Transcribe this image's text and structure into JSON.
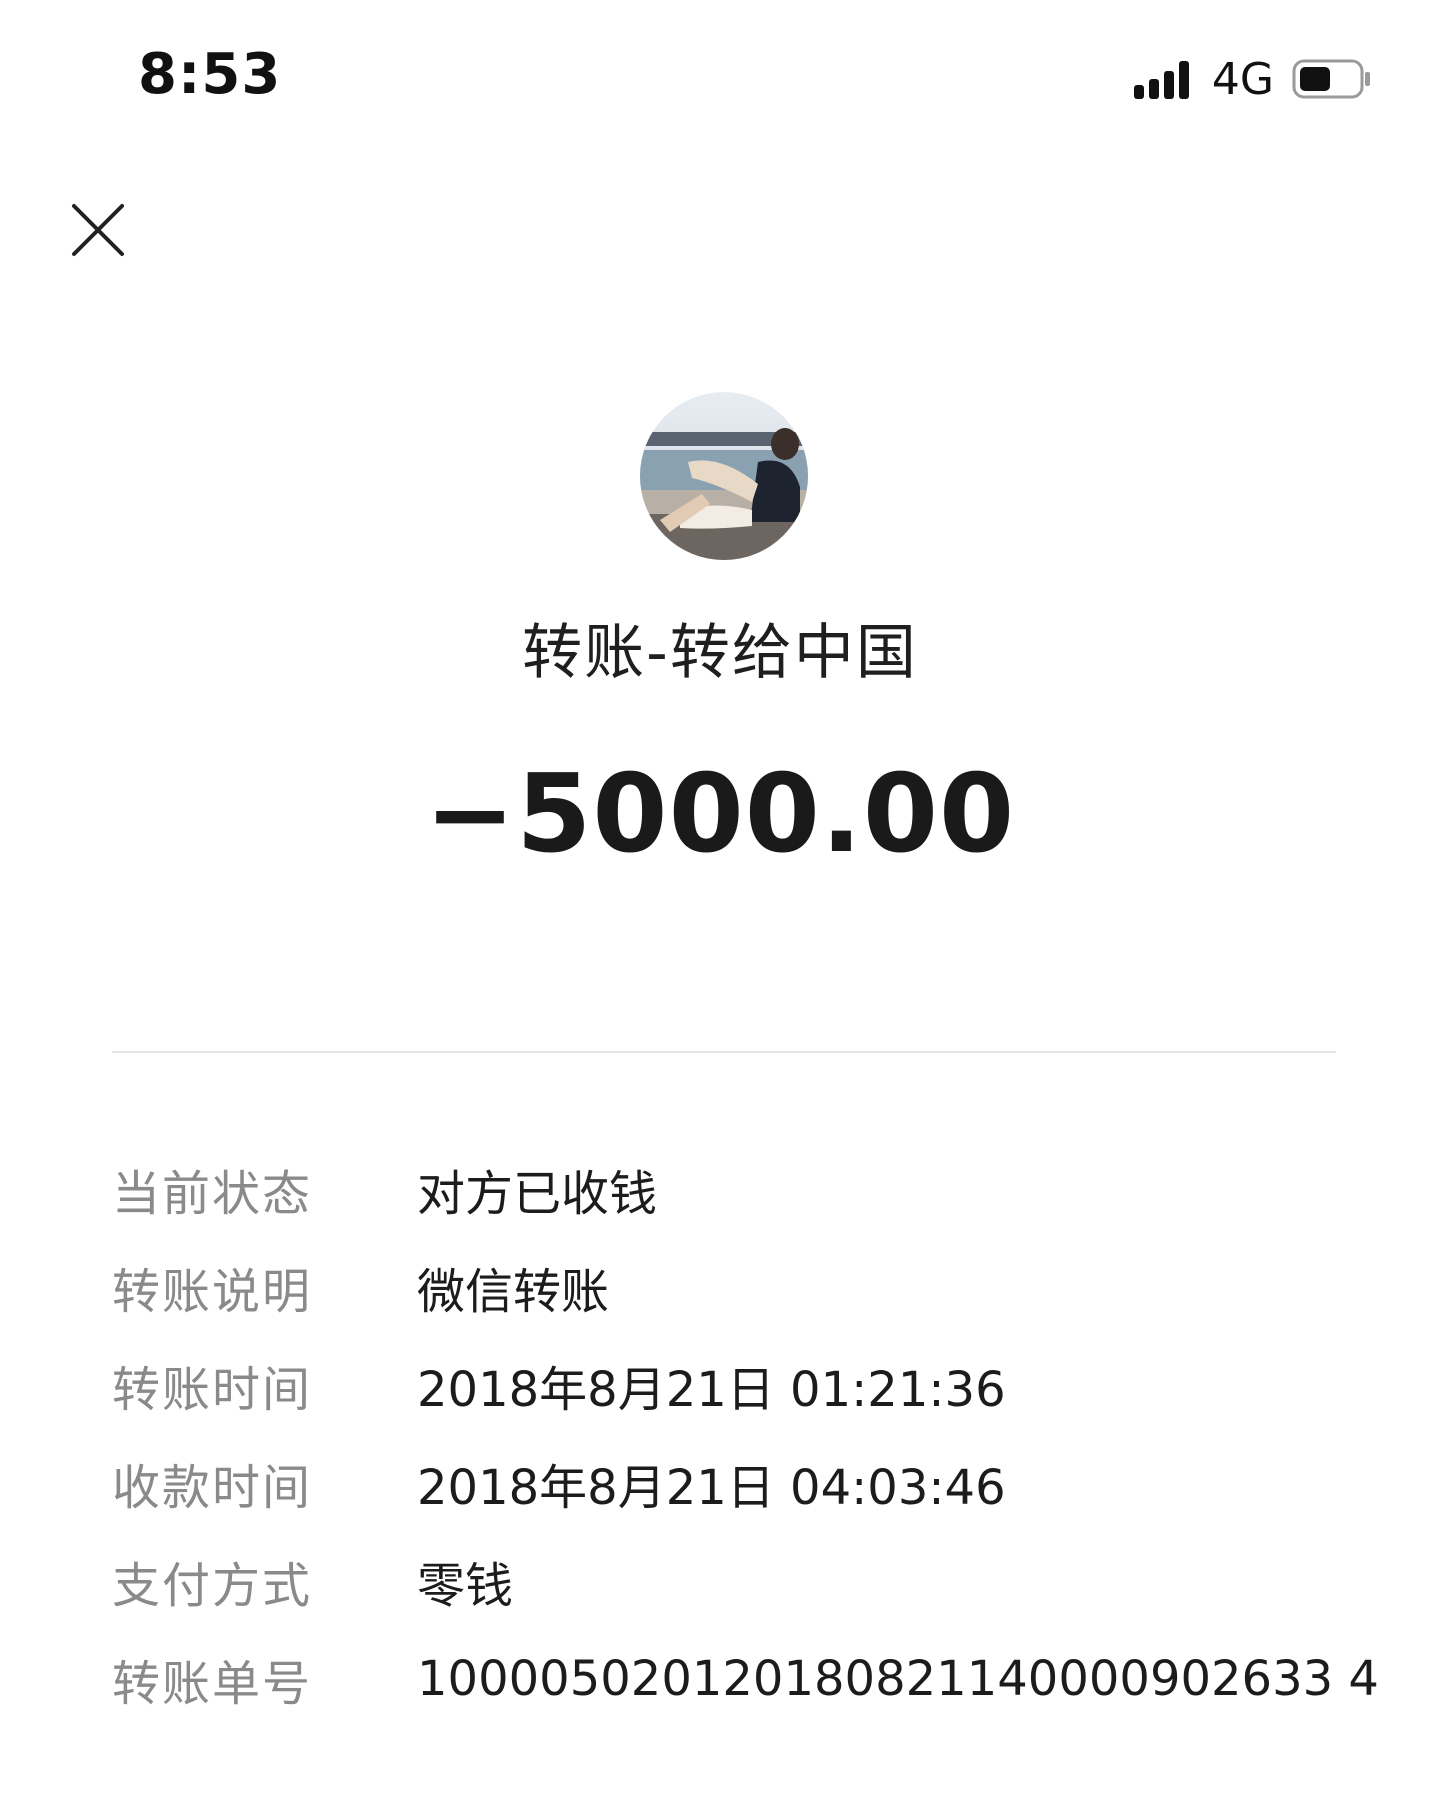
{
  "status_bar": {
    "time": "8:53",
    "network": "4G",
    "signal_icon": "signal-bars-icon",
    "battery_icon": "battery-icon"
  },
  "header": {
    "close_icon": "close-icon"
  },
  "transfer": {
    "avatar_icon": "avatar",
    "title": "转账-转给中国",
    "amount": "−5000.00"
  },
  "details": [
    {
      "label": "当前状态",
      "value": "对方已收钱"
    },
    {
      "label": "转账说明",
      "value": "微信转账"
    },
    {
      "label": "转账时间",
      "value": "2018年8月21日 01:21:36"
    },
    {
      "label": "收款时间",
      "value": "2018年8月21日 04:03:46"
    },
    {
      "label": "支付方式",
      "value": "零钱"
    },
    {
      "label": "转账单号",
      "value": "100005020120180821140000902633 4"
    }
  ],
  "colors": {
    "text_primary": "#1a1a1a",
    "text_secondary": "#8a8a8a",
    "divider": "#e6e6e6",
    "background": "#ffffff"
  }
}
